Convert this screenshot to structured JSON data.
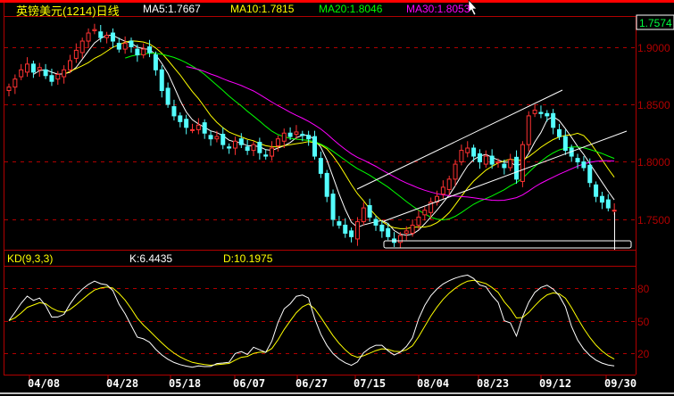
{
  "header": {
    "title": "英镑美元(1214)日线",
    "ma5": "MA5:1.7667",
    "ma10": "MA10:1.7815",
    "ma20": "MA20:1.8046",
    "ma30": "MA30:1.8053",
    "last_price": "1.7574"
  },
  "kd": {
    "label": "KD(9,3,3)",
    "k": "K:6.4435",
    "d": "D:10.1975"
  },
  "colors": {
    "up": "#ff3232",
    "down": "#54ffff",
    "ma5": "#ffffff",
    "ma10": "#ffff00",
    "ma20": "#00ff00",
    "ma30": "#ff00ff",
    "axis": "#b00000"
  },
  "chart_data": [
    {
      "type": "candlestick",
      "title": "英镑美元(1214)日线",
      "ylim": [
        1.72,
        1.92
      ],
      "y_ticks": [
        "1.9000",
        "1.8500",
        "1.8000",
        "1.7500"
      ],
      "x_ticks": [
        "04/08",
        "04/28",
        "05/18",
        "06/07",
        "06/27",
        "07/15",
        "08/04",
        "08/23",
        "09/12",
        "09/30"
      ],
      "closes": [
        1.865,
        1.872,
        1.88,
        1.885,
        1.878,
        1.882,
        1.875,
        1.87,
        1.876,
        1.88,
        1.888,
        1.897,
        1.905,
        1.912,
        1.915,
        1.908,
        1.91,
        1.905,
        1.898,
        1.903,
        1.9,
        1.893,
        1.898,
        1.895,
        1.88,
        1.862,
        1.85,
        1.84,
        1.835,
        1.83,
        1.828,
        1.832,
        1.825,
        1.82,
        1.822,
        1.815,
        1.812,
        1.818,
        1.815,
        1.81,
        1.815,
        1.808,
        1.805,
        1.812,
        1.82,
        1.825,
        1.822,
        1.826,
        1.823,
        1.82,
        1.805,
        1.79,
        1.77,
        1.75,
        1.745,
        1.738,
        1.735,
        1.748,
        1.76,
        1.752,
        1.745,
        1.74,
        1.735,
        1.73,
        1.736,
        1.74,
        1.745,
        1.752,
        1.758,
        1.765,
        1.77,
        1.778,
        1.785,
        1.798,
        1.81,
        1.812,
        1.805,
        1.8,
        1.805,
        1.798,
        1.8,
        1.795,
        1.802,
        1.785,
        1.815,
        1.84,
        1.845,
        1.842,
        1.84,
        1.83,
        1.822,
        1.81,
        1.805,
        1.8,
        1.795,
        1.782,
        1.77,
        1.765,
        1.76,
        1.758
      ],
      "moving_averages": [
        5,
        10,
        20,
        30
      ]
    },
    {
      "type": "line",
      "title": "KD(9,3,3)",
      "ylim": [
        0,
        100
      ],
      "y_ticks": [
        "80",
        "50",
        "20"
      ],
      "series": [
        "K",
        "D"
      ]
    }
  ]
}
